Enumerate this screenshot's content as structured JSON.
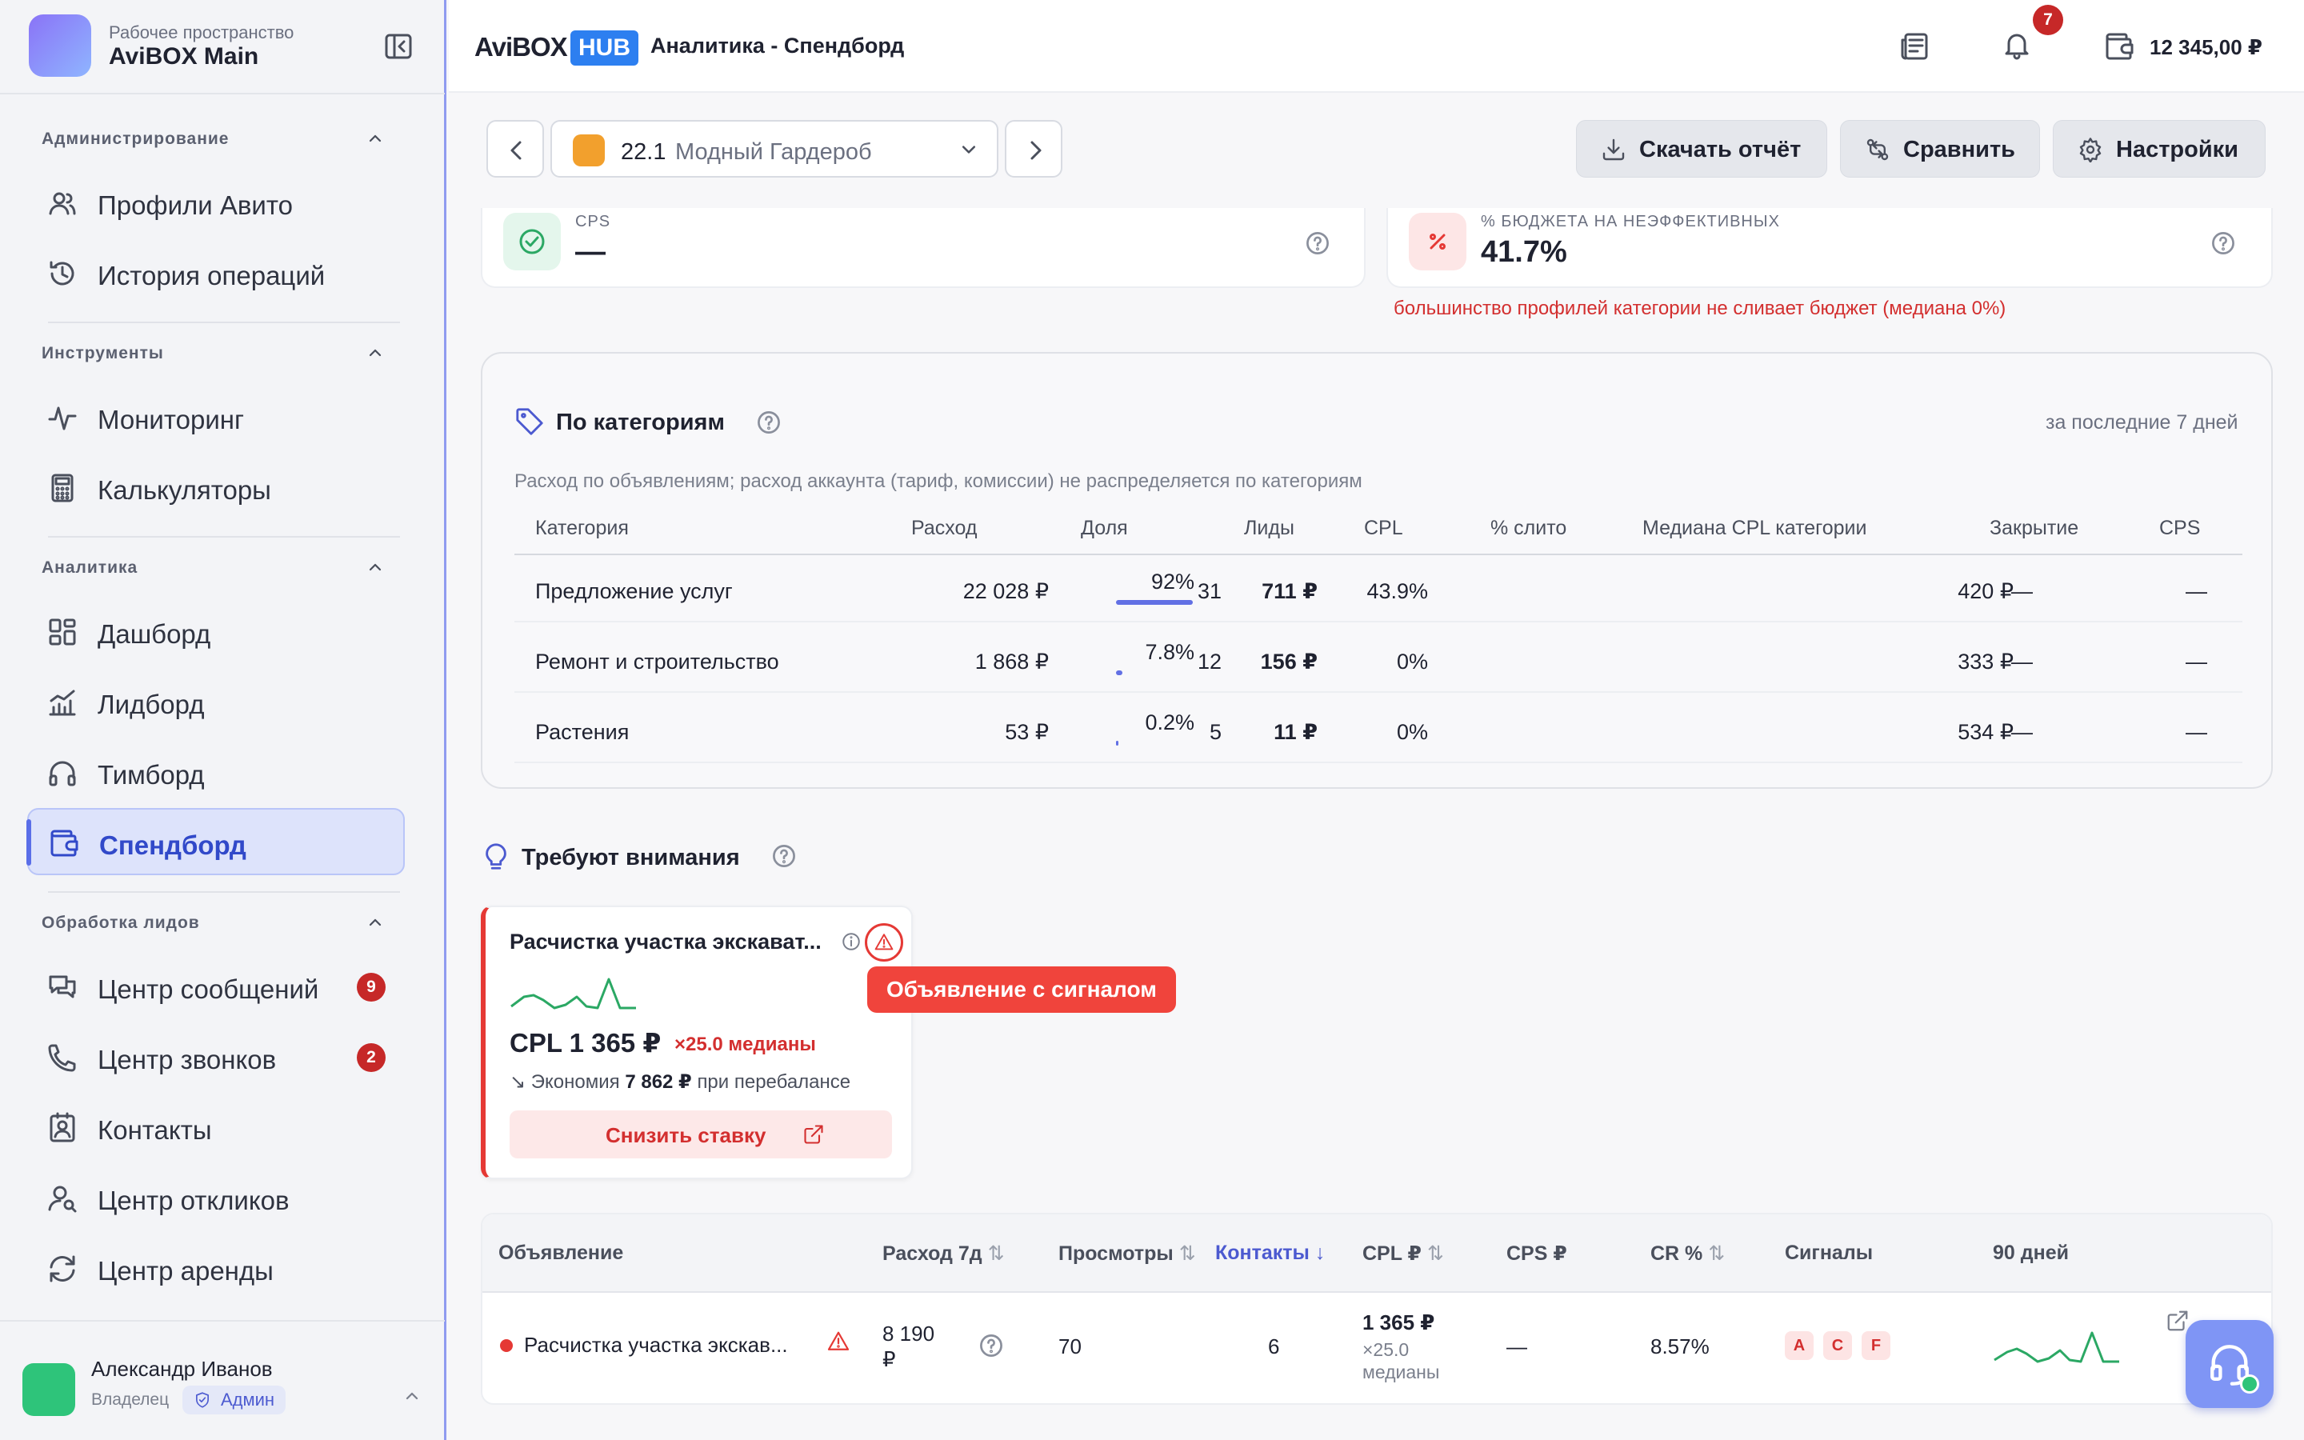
{
  "workspace": {
    "label": "Рабочее пространство",
    "name": "AviBOX Main"
  },
  "sidebar": {
    "sections": [
      {
        "title": "Администрирование",
        "items": [
          {
            "label": "Профили Авито"
          },
          {
            "label": "История операций"
          }
        ]
      },
      {
        "title": "Инструменты",
        "items": [
          {
            "label": "Мониторинг"
          },
          {
            "label": "Калькуляторы"
          }
        ]
      },
      {
        "title": "Аналитика",
        "items": [
          {
            "label": "Дашборд"
          },
          {
            "label": "Лидборд"
          },
          {
            "label": "Тимборд"
          },
          {
            "label": "Спендборд"
          }
        ]
      },
      {
        "title": "Обработка лидов",
        "items": [
          {
            "label": "Центр сообщений",
            "badge": "9"
          },
          {
            "label": "Центр звонков",
            "badge": "2"
          },
          {
            "label": "Контакты"
          },
          {
            "label": "Центр откликов"
          },
          {
            "label": "Центр аренды"
          }
        ]
      }
    ],
    "active_item": "Спендборд"
  },
  "user": {
    "name": "Александр Иванов",
    "role": "Владелец",
    "badge": "Админ"
  },
  "header": {
    "brand_a": "AviBOX",
    "brand_b": "HUB",
    "title": "Аналитика - Спендборд",
    "notifications": "7",
    "balance": "12 345,00 ₽"
  },
  "toolbar": {
    "profile_num": "22.1",
    "profile_name": "Модный Гардероб",
    "download": "Скачать отчёт",
    "compare": "Сравнить",
    "settings": "Настройки"
  },
  "stats": {
    "cps": {
      "label": "CPS",
      "value": "—"
    },
    "waste": {
      "label": "% БЮДЖЕТА НА НЕЭФФЕКТИВНЫХ",
      "value": "41.7%",
      "note": "большинство профилей категории не сливает бюджет (медиана 0%)"
    }
  },
  "categories": {
    "title": "По категориям",
    "period": "за последние 7 дней",
    "note": "Расход по объявлениям; расход аккаунта (тариф, комиссии) не распределяется по категориям",
    "columns": [
      "Категория",
      "Расход",
      "Доля",
      "Лиды",
      "CPL",
      "% слито",
      "Медиана CPL категории",
      "Закрытие",
      "CPS"
    ],
    "rows": [
      {
        "name": "Предложение услуг",
        "spend": "22 028 ₽",
        "share": "92%",
        "share_value": 92,
        "leads": "31",
        "cpl": "711 ₽",
        "wasted": "43.9%",
        "median": "420 ₽",
        "close": "—",
        "cps": "—"
      },
      {
        "name": "Ремонт и строительство",
        "spend": "1 868 ₽",
        "share": "7.8%",
        "share_value": 7.8,
        "leads": "12",
        "cpl": "156 ₽",
        "wasted": "0%",
        "median": "333 ₽",
        "close": "—",
        "cps": "—"
      },
      {
        "name": "Растения",
        "spend": "53 ₽",
        "share": "0.2%",
        "share_value": 0.2,
        "leads": "5",
        "cpl": "11 ₽",
        "wasted": "0%",
        "median": "534 ₽",
        "close": "—",
        "cps": "—"
      }
    ]
  },
  "attention": {
    "title": "Требуют внимания",
    "card": {
      "title": "Расчистка участка экскават...",
      "cpl": "CPL 1 365 ₽",
      "multiplier": "×25.0 медианы",
      "economy_prefix": "Экономия",
      "economy_value": "7 862 ₽",
      "economy_suffix": "при перебалансе",
      "button": "Снизить ставку"
    },
    "tooltip": "Объявление с сигналом"
  },
  "ads": {
    "columns": {
      "ad": "Объявление",
      "spend": "Расход 7д",
      "views": "Просмотры",
      "contacts": "Контакты",
      "cpl": "CPL ₽",
      "cps": "CPS ₽",
      "cr": "CR %",
      "signals": "Сигналы",
      "days": "90 дней"
    },
    "sort_icon": "⇅",
    "sort_active_icon": "↓",
    "row": {
      "name": "Расчистка участка экскав...",
      "spend_line1": "8 190",
      "spend_line2": "₽",
      "views": "70",
      "contacts": "6",
      "cpl_main": "1 365 ₽",
      "cpl_sub1": "×25.0",
      "cpl_sub2": "медианы",
      "cps": "—",
      "cr": "8.57%",
      "signals": [
        "A",
        "C",
        "F"
      ]
    }
  },
  "colors": {
    "accent": "#4c5ad0",
    "danger": "#e53935",
    "success": "#2ec47a",
    "brand_blue": "#2d7ff0"
  }
}
